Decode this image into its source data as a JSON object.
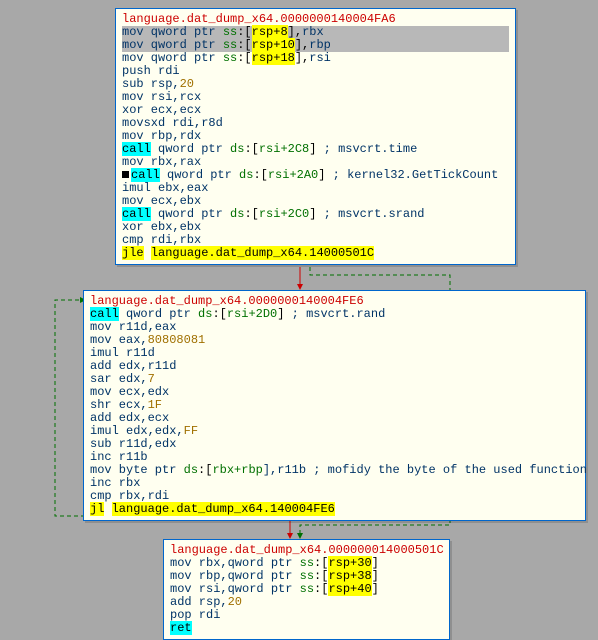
{
  "block1": {
    "title": "language.dat_dump_x64.0000000140004FA6",
    "l1a": "mov qword ptr ",
    "l1b": "ss",
    "l1c": ":[",
    "l1d": "rsp+8",
    "l1e": "],",
    "l1f": "rbx",
    "l2a": "mov qword ptr ",
    "l2b": "ss",
    "l2c": ":[",
    "l2d": "rsp+10",
    "l2e": "],",
    "l2f": "rbp",
    "l3a": "mov qword ptr ",
    "l3b": "ss",
    "l3c": ":[",
    "l3d": "rsp+18",
    "l3e": "],",
    "l3f": "rsi",
    "l4": "push rdi",
    "l5a": "sub rsp,",
    "l5b": "20",
    "l6": "mov rsi,rcx",
    "l7": "xor ecx,ecx",
    "l8": "movsxd rdi,r8d",
    "l9": "mov rbp,rdx",
    "l10a": "call",
    "l10b": " qword ptr ",
    "l10c": "ds",
    "l10d": ":[",
    "l10e": "rsi+2C8",
    "l10f": "]",
    "l10g": " ; msvcrt.time",
    "l11": "mov rbx,rax",
    "l12a": "call",
    "l12b": " qword ptr ",
    "l12c": "ds",
    "l12d": ":[",
    "l12e": "rsi+2A0",
    "l12f": "]",
    "l12g": " ; kernel32.GetTickCount",
    "l13": "imul ebx,eax",
    "l14": "mov ecx,ebx",
    "l15a": "call",
    "l15b": " qword ptr ",
    "l15c": "ds",
    "l15d": ":[",
    "l15e": "rsi+2C0",
    "l15f": "]",
    "l15g": " ; msvcrt.srand",
    "l16": "xor ebx,ebx",
    "l17": "cmp rdi,rbx",
    "l18a": "jle",
    "l18b": " ",
    "l18c": "language.dat_dump_x64.14000501C"
  },
  "block2": {
    "title": "language.dat_dump_x64.0000000140004FE6",
    "l1a": "call",
    "l1b": " qword ptr ",
    "l1c": "ds",
    "l1d": ":[",
    "l1e": "rsi+2D0",
    "l1f": "]",
    "l1g": " ; msvcrt.rand",
    "l2": "mov r11d,eax",
    "l3a": "mov eax,",
    "l3b": "80808081",
    "l4": "imul r11d",
    "l5": "add edx,r11d",
    "l6a": "sar edx,",
    "l6b": "7",
    "l7": "mov ecx,edx",
    "l8a": "shr ecx,",
    "l8b": "1F",
    "l9": "add edx,ecx",
    "l10a": "imul edx,edx,",
    "l10b": "FF",
    "l11": "sub r11d,edx",
    "l12": "inc r11b",
    "l13a": "mov byte ptr ",
    "l13b": "ds",
    "l13c": ":[",
    "l13d": "rbx+rbp",
    "l13e": "],r11b ",
    "l13f": "; mofidy the byte of the used function",
    "l14": "inc rbx",
    "l15": "cmp rbx,rdi",
    "l16a": "jl",
    "l16b": " ",
    "l16c": "language.dat_dump_x64.140004FE6"
  },
  "block3": {
    "title": "language.dat_dump_x64.000000014000501C",
    "l1a": "mov rbx,qword ptr ",
    "l1b": "ss",
    "l1c": ":[",
    "l1d": "rsp+30",
    "l1e": "]",
    "l2a": "mov rbp,qword ptr ",
    "l2b": "ss",
    "l2c": ":[",
    "l2d": "rsp+38",
    "l2e": "]",
    "l3a": "mov rsi,qword ptr ",
    "l3b": "ss",
    "l3c": ":[",
    "l3d": "rsp+40",
    "l3e": "]",
    "l4a": "add rsp,",
    "l4b": "20",
    "l5": "pop rdi",
    "l6": "ret"
  }
}
